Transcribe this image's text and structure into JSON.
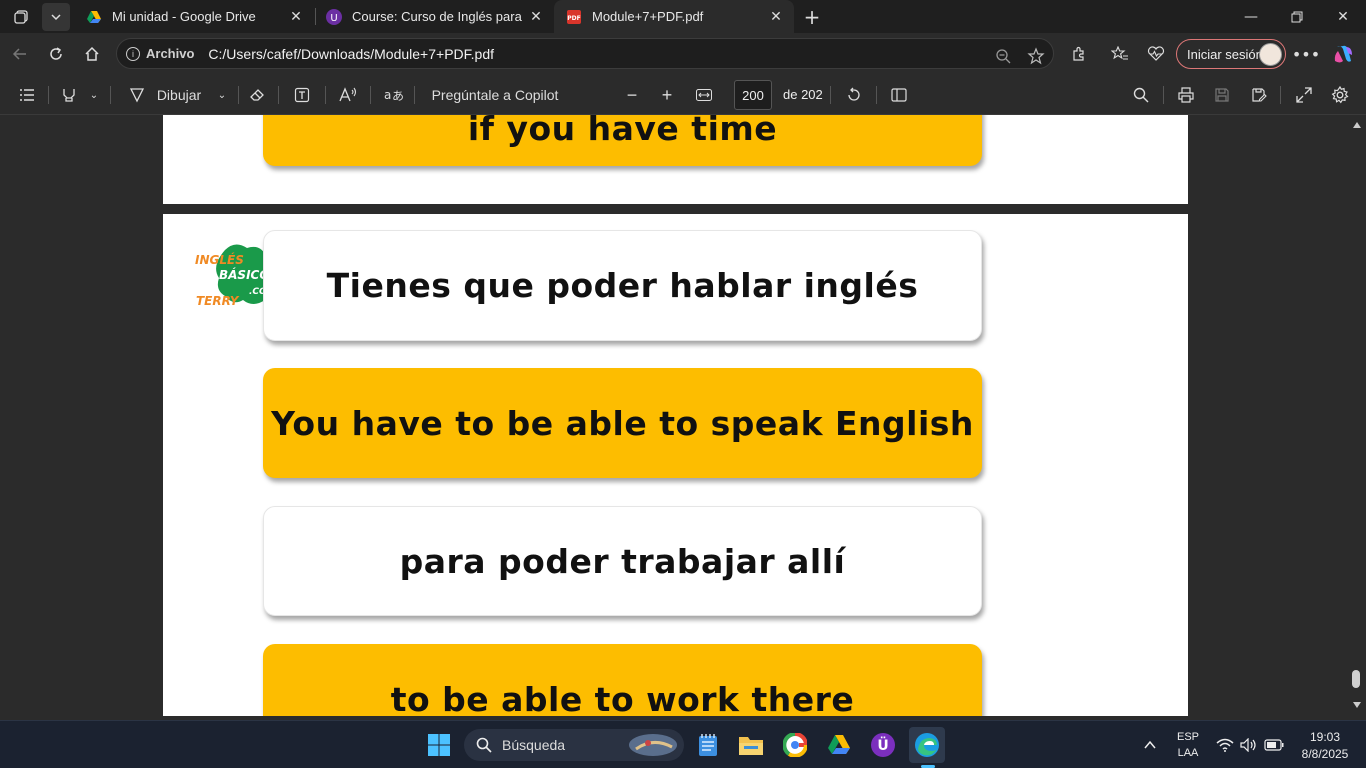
{
  "tabs": [
    {
      "title": "Mi unidad - Google Drive",
      "active": false
    },
    {
      "title": "Course: Curso de Inglés para principiantes",
      "active": false
    },
    {
      "title": "Module+7+PDF.pdf",
      "active": true
    }
  ],
  "address": {
    "scheme_label": "Archivo",
    "url": "C:/Users/cafef/Downloads/Module+7+PDF.pdf",
    "signin_label": "Iniciar sesión"
  },
  "pdf_toolbar": {
    "draw_label": "Dibujar",
    "copilot_label": "Pregúntale a Copilot",
    "page_current": "200",
    "page_total_label": "de 202"
  },
  "document": {
    "prev_card_text": "if you have time",
    "logo_text": [
      "INGLÉS",
      "BÁSICO",
      "TERRY",
      ".COM"
    ],
    "cards": [
      {
        "text": "Tienes que poder hablar inglés",
        "style": "white"
      },
      {
        "text": "You have to be able to speak English",
        "style": "yellow"
      },
      {
        "text": "para poder trabajar allí",
        "style": "white"
      },
      {
        "text": "to be able to work there",
        "style": "yellow"
      }
    ],
    "colors": {
      "yellow": "#fdbd00",
      "logo_green": "#1a9a4a",
      "logo_orange": "#f08a24"
    }
  },
  "taskbar": {
    "search_placeholder": "Búsqueda",
    "lang_top": "ESP",
    "lang_bottom": "LAA",
    "time": "19:03",
    "date": "8/8/2025"
  }
}
